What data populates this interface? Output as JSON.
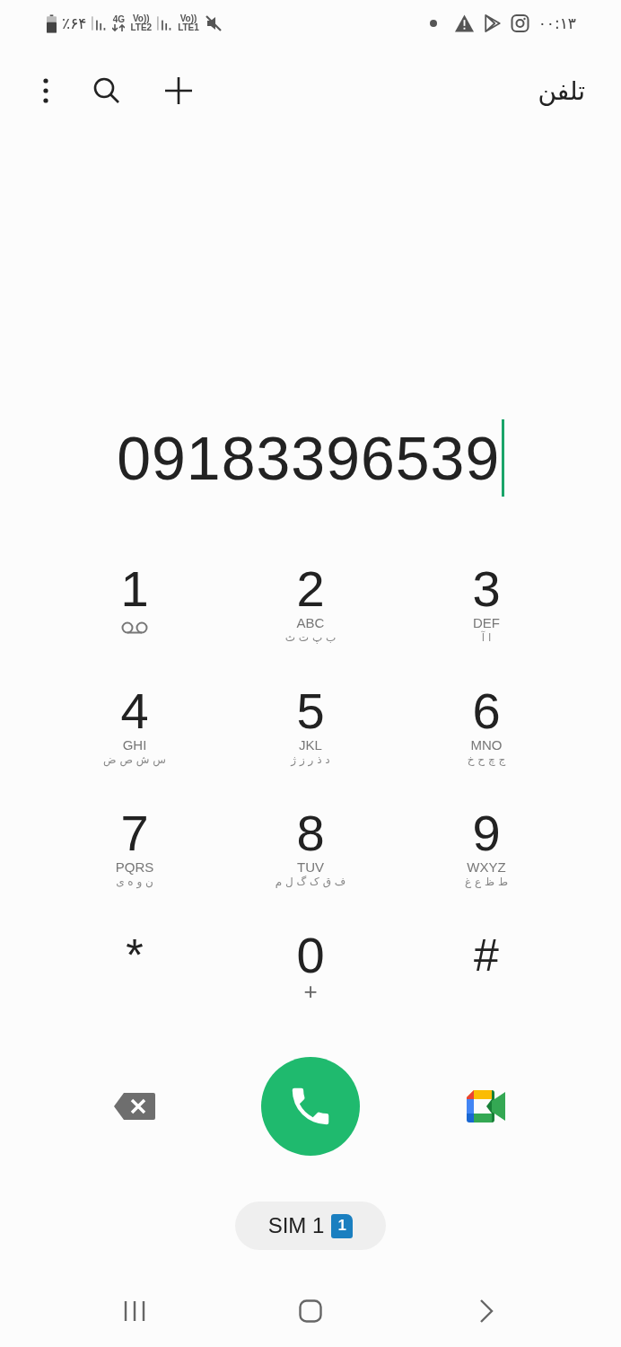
{
  "status_bar": {
    "battery_text": "٪۶۴",
    "network_type": "4G",
    "sim_signals": [
      {
        "volte": "Vo))",
        "label": "LTE1"
      },
      {
        "volte": "Vo))",
        "label": "LTE2"
      }
    ],
    "time": "۰۰:۱۳"
  },
  "toolbar": {
    "title": "تلفن"
  },
  "dialed_number": "09183396539",
  "keys": [
    {
      "kind": "letters",
      "digit": "3",
      "latin": "DEF",
      "persian": "ا آ"
    },
    {
      "kind": "letters",
      "digit": "2",
      "latin": "ABC",
      "persian": "ب پ ت ث"
    },
    {
      "kind": "voicemail",
      "digit": "1"
    },
    {
      "kind": "letters",
      "digit": "6",
      "latin": "MNO",
      "persian": "ج چ ح خ"
    },
    {
      "kind": "letters",
      "digit": "5",
      "latin": "JKL",
      "persian": "د ذ ر ز ژ"
    },
    {
      "kind": "letters",
      "digit": "4",
      "latin": "GHI",
      "persian": "س ش ص ض"
    },
    {
      "kind": "letters",
      "digit": "9",
      "latin": "WXYZ",
      "persian": "ط ظ ع غ"
    },
    {
      "kind": "letters",
      "digit": "8",
      "latin": "TUV",
      "persian": "ف ق ک گ ل م"
    },
    {
      "kind": "letters",
      "digit": "7",
      "latin": "PQRS",
      "persian": "ن و ه ی"
    },
    {
      "kind": "symbol",
      "digit": "#"
    },
    {
      "kind": "plus",
      "digit": "0",
      "sub": "+"
    },
    {
      "kind": "symbol",
      "digit": "*"
    }
  ],
  "sim_button": {
    "label": "SIM 1",
    "badge": "1"
  }
}
